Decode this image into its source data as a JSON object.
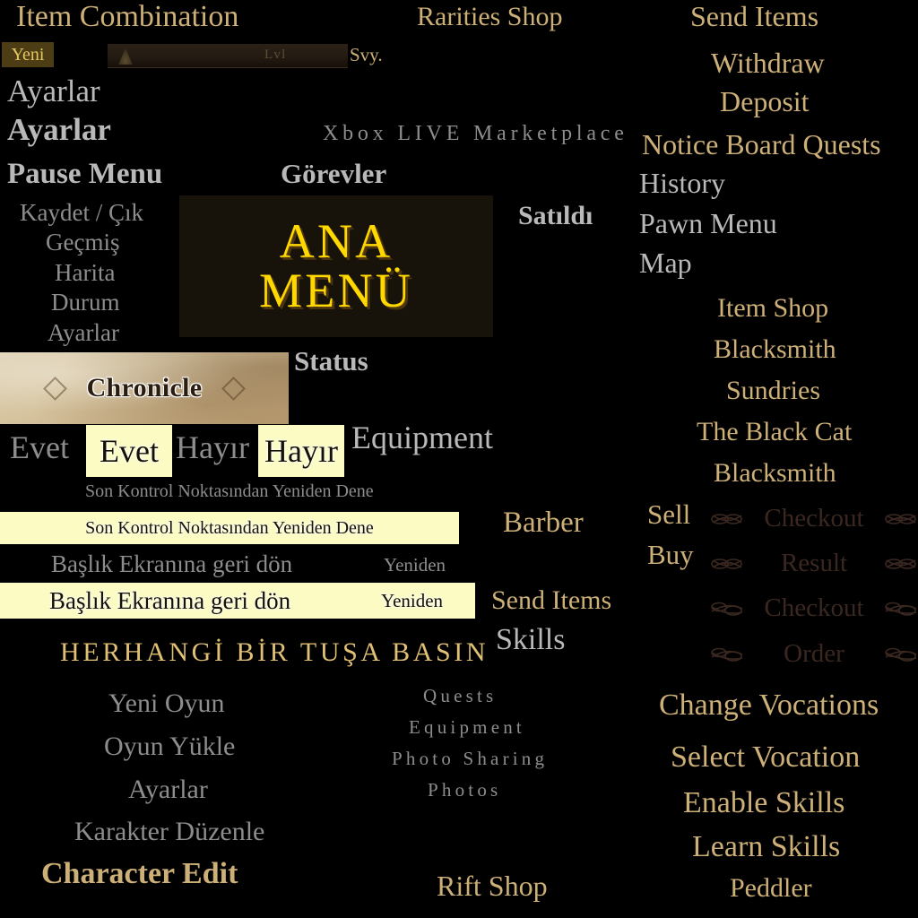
{
  "title_plate": {
    "line1": "ANA",
    "line2": "MENÜ"
  },
  "hud": {
    "level_text": "Lvl",
    "suffix": "Svy.",
    "new_tag": "Yeni"
  },
  "chronicle": {
    "label": "Chronicle"
  },
  "top_labels": {
    "item_combination": "Item Combination",
    "rarities_shop": "Rarities Shop",
    "send_items": "Send Items",
    "withdraw": "Withdraw",
    "deposit": "Deposit",
    "notice_board_quests": "Notice Board Quests",
    "history": "History",
    "pawn_menu": "Pawn Menu",
    "map": "Map",
    "xbox_live": "Xbox LIVE Marketplace",
    "gorevler": "Görevler",
    "satildi": "Satıldı",
    "status": "Status",
    "equipment": "Equipment",
    "barber": "Barber",
    "send_items_2": "Send Items",
    "skills": "Skills",
    "rift_shop": "Rift Shop"
  },
  "settings_labels": {
    "ayarlar_1": "Ayarlar",
    "ayarlar_2": "Ayarlar"
  },
  "pause_menu": {
    "title": "Pause Menu",
    "items": [
      "Kaydet / Çık",
      "Geçmiş",
      "Harita",
      "Durum",
      "Ayarlar"
    ]
  },
  "confirm": {
    "yes_plain": "Evet",
    "yes_selected": "Evet",
    "no_plain": "Hayır",
    "no_selected": "Hayır"
  },
  "retry": {
    "checkpoint_plain": "Son Kontrol Noktasından Yeniden Dene",
    "checkpoint_selected": "Son Kontrol Noktasından Yeniden Dene",
    "title_screen_plain": "Başlık Ekranına geri dön",
    "title_screen_selected": "Başlık Ekranına geri dön",
    "again_plain": "Yeniden",
    "again_selected": "Yeniden"
  },
  "press_any_key": "HERHANGİ BİR TUŞA BASIN",
  "main_menu": {
    "items": [
      "Yeni Oyun",
      "Oyun Yükle",
      "Ayarlar",
      "Karakter Düzenle"
    ],
    "character_edit": "Character Edit"
  },
  "share_menu": {
    "items": [
      "Quests",
      "Equipment",
      "Photo Sharing",
      "Photos"
    ]
  },
  "shops": {
    "item_shop": "Item Shop",
    "blacksmith": "Blacksmith",
    "sundries": "Sundries",
    "black_cat": "The Black Cat",
    "blacksmith_2": "Blacksmith",
    "sell": "Sell",
    "buy": "Buy"
  },
  "transactions": {
    "rows": [
      "Checkout",
      "Result",
      "Checkout",
      "Order"
    ]
  },
  "vocations": {
    "change": "Change Vocations",
    "select": "Select Vocation",
    "enable": "Enable Skills",
    "learn": "Learn Skills",
    "peddler": "Peddler"
  },
  "colors": {
    "gold": "#cdb077",
    "title_gold": "#ffd800",
    "silver": "#b9b9b9",
    "highlight_bg": "#fbfbc3",
    "dark_engrave": "#3a2820",
    "parchment": "#d6c49f",
    "tag_bg": "#4d3d14"
  }
}
